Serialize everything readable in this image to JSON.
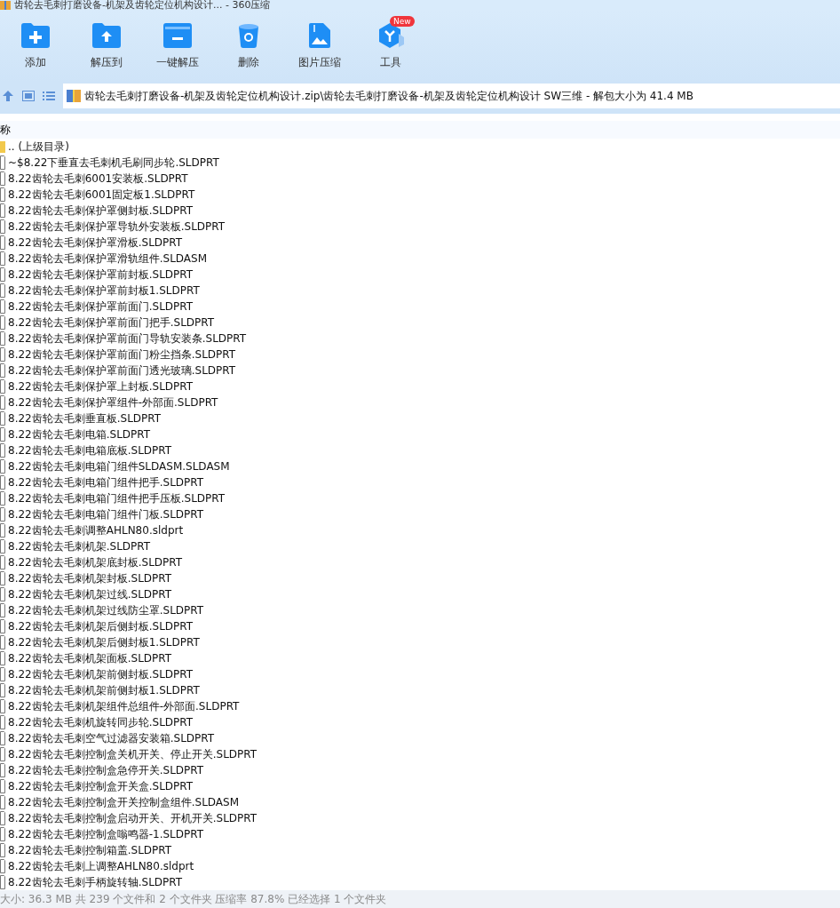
{
  "window": {
    "title": "齿轮去毛刺打磨设备-机架及齿轮定位机构设计... - 360压缩"
  },
  "toolbar": [
    {
      "label": "添加",
      "kind": "add"
    },
    {
      "label": "解压到",
      "kind": "extract"
    },
    {
      "label": "一键解压",
      "kind": "oneclick"
    },
    {
      "label": "删除",
      "kind": "delete"
    },
    {
      "label": "图片压缩",
      "kind": "image"
    },
    {
      "label": "工具",
      "kind": "tools",
      "badge": "New"
    }
  ],
  "address_bar": {
    "path": "齿轮去毛刺打磨设备-机架及齿轮定位机构设计.zip\\齿轮去毛刺打磨设备-机架及齿轮定位机构设计 SW三维 - 解包大小为 41.4 MB"
  },
  "table": {
    "columns": [
      "称"
    ],
    "rows": [
      {
        "name": ".. (上级目录)",
        "kind": "folder"
      },
      {
        "name": "~$8.22下垂直去毛刺机毛刷同步轮.SLDPRT",
        "kind": "file"
      },
      {
        "name": "8.22齿轮去毛刺6001安装板.SLDPRT",
        "kind": "file"
      },
      {
        "name": "8.22齿轮去毛刺6001固定板1.SLDPRT",
        "kind": "file"
      },
      {
        "name": "8.22齿轮去毛刺保护罩侧封板.SLDPRT",
        "kind": "file"
      },
      {
        "name": "8.22齿轮去毛刺保护罩导轨外安装板.SLDPRT",
        "kind": "file"
      },
      {
        "name": "8.22齿轮去毛刺保护罩滑板.SLDPRT",
        "kind": "file"
      },
      {
        "name": "8.22齿轮去毛刺保护罩滑轨组件.SLDASM",
        "kind": "file"
      },
      {
        "name": "8.22齿轮去毛刺保护罩前封板.SLDPRT",
        "kind": "file"
      },
      {
        "name": "8.22齿轮去毛刺保护罩前封板1.SLDPRT",
        "kind": "file"
      },
      {
        "name": "8.22齿轮去毛刺保护罩前面门.SLDPRT",
        "kind": "file"
      },
      {
        "name": "8.22齿轮去毛刺保护罩前面门把手.SLDPRT",
        "kind": "file"
      },
      {
        "name": "8.22齿轮去毛刺保护罩前面门导轨安装条.SLDPRT",
        "kind": "file"
      },
      {
        "name": "8.22齿轮去毛刺保护罩前面门粉尘挡条.SLDPRT",
        "kind": "file"
      },
      {
        "name": "8.22齿轮去毛刺保护罩前面门透光玻璃.SLDPRT",
        "kind": "file"
      },
      {
        "name": "8.22齿轮去毛刺保护罩上封板.SLDPRT",
        "kind": "file"
      },
      {
        "name": "8.22齿轮去毛刺保护罩组件-外部面.SLDPRT",
        "kind": "file"
      },
      {
        "name": "8.22齿轮去毛刺垂直板.SLDPRT",
        "kind": "file"
      },
      {
        "name": "8.22齿轮去毛刺电箱.SLDPRT",
        "kind": "file"
      },
      {
        "name": "8.22齿轮去毛刺电箱底板.SLDPRT",
        "kind": "file"
      },
      {
        "name": "8.22齿轮去毛刺电箱门组件SLDASM.SLDASM",
        "kind": "file"
      },
      {
        "name": "8.22齿轮去毛刺电箱门组件把手.SLDPRT",
        "kind": "file"
      },
      {
        "name": "8.22齿轮去毛刺电箱门组件把手压板.SLDPRT",
        "kind": "file"
      },
      {
        "name": "8.22齿轮去毛刺电箱门组件门板.SLDPRT",
        "kind": "file"
      },
      {
        "name": "8.22齿轮去毛刺调整AHLN80.sldprt",
        "kind": "file"
      },
      {
        "name": "8.22齿轮去毛刺机架.SLDPRT",
        "kind": "file"
      },
      {
        "name": "8.22齿轮去毛刺机架底封板.SLDPRT",
        "kind": "file"
      },
      {
        "name": "8.22齿轮去毛刺机架封板.SLDPRT",
        "kind": "file"
      },
      {
        "name": "8.22齿轮去毛刺机架过线.SLDPRT",
        "kind": "file"
      },
      {
        "name": "8.22齿轮去毛刺机架过线防尘罩.SLDPRT",
        "kind": "file"
      },
      {
        "name": "8.22齿轮去毛刺机架后侧封板.SLDPRT",
        "kind": "file"
      },
      {
        "name": "8.22齿轮去毛刺机架后侧封板1.SLDPRT",
        "kind": "file"
      },
      {
        "name": "8.22齿轮去毛刺机架面板.SLDPRT",
        "kind": "file"
      },
      {
        "name": "8.22齿轮去毛刺机架前侧封板.SLDPRT",
        "kind": "file"
      },
      {
        "name": "8.22齿轮去毛刺机架前侧封板1.SLDPRT",
        "kind": "file"
      },
      {
        "name": "8.22齿轮去毛刺机架组件总组件-外部面.SLDPRT",
        "kind": "file"
      },
      {
        "name": "8.22齿轮去毛刺机旋转同步轮.SLDPRT",
        "kind": "file"
      },
      {
        "name": "8.22齿轮去毛刺空气过滤器安装箱.SLDPRT",
        "kind": "file"
      },
      {
        "name": "8.22齿轮去毛刺控制盒关机开关、停止开关.SLDPRT",
        "kind": "file"
      },
      {
        "name": "8.22齿轮去毛刺控制盒急停开关.SLDPRT",
        "kind": "file"
      },
      {
        "name": "8.22齿轮去毛刺控制盒开关盒.SLDPRT",
        "kind": "file"
      },
      {
        "name": "8.22齿轮去毛刺控制盒开关控制盒组件.SLDASM",
        "kind": "file"
      },
      {
        "name": "8.22齿轮去毛刺控制盒启动开关、开机开关.SLDPRT",
        "kind": "file"
      },
      {
        "name": "8.22齿轮去毛刺控制盒嗡鸣器-1.SLDPRT",
        "kind": "file"
      },
      {
        "name": "8.22齿轮去毛刺控制箱盖.SLDPRT",
        "kind": "file"
      },
      {
        "name": "8.22齿轮去毛刺上调整AHLN80.sldprt",
        "kind": "file"
      },
      {
        "name": "8.22齿轮去毛刺手柄旋转轴.SLDPRT",
        "kind": "file"
      }
    ]
  },
  "status_bar": "大小: 36.3 MB 共 239 个文件和 2 个文件夹 压缩率 87.8% 已经选择 1 个文件夹"
}
